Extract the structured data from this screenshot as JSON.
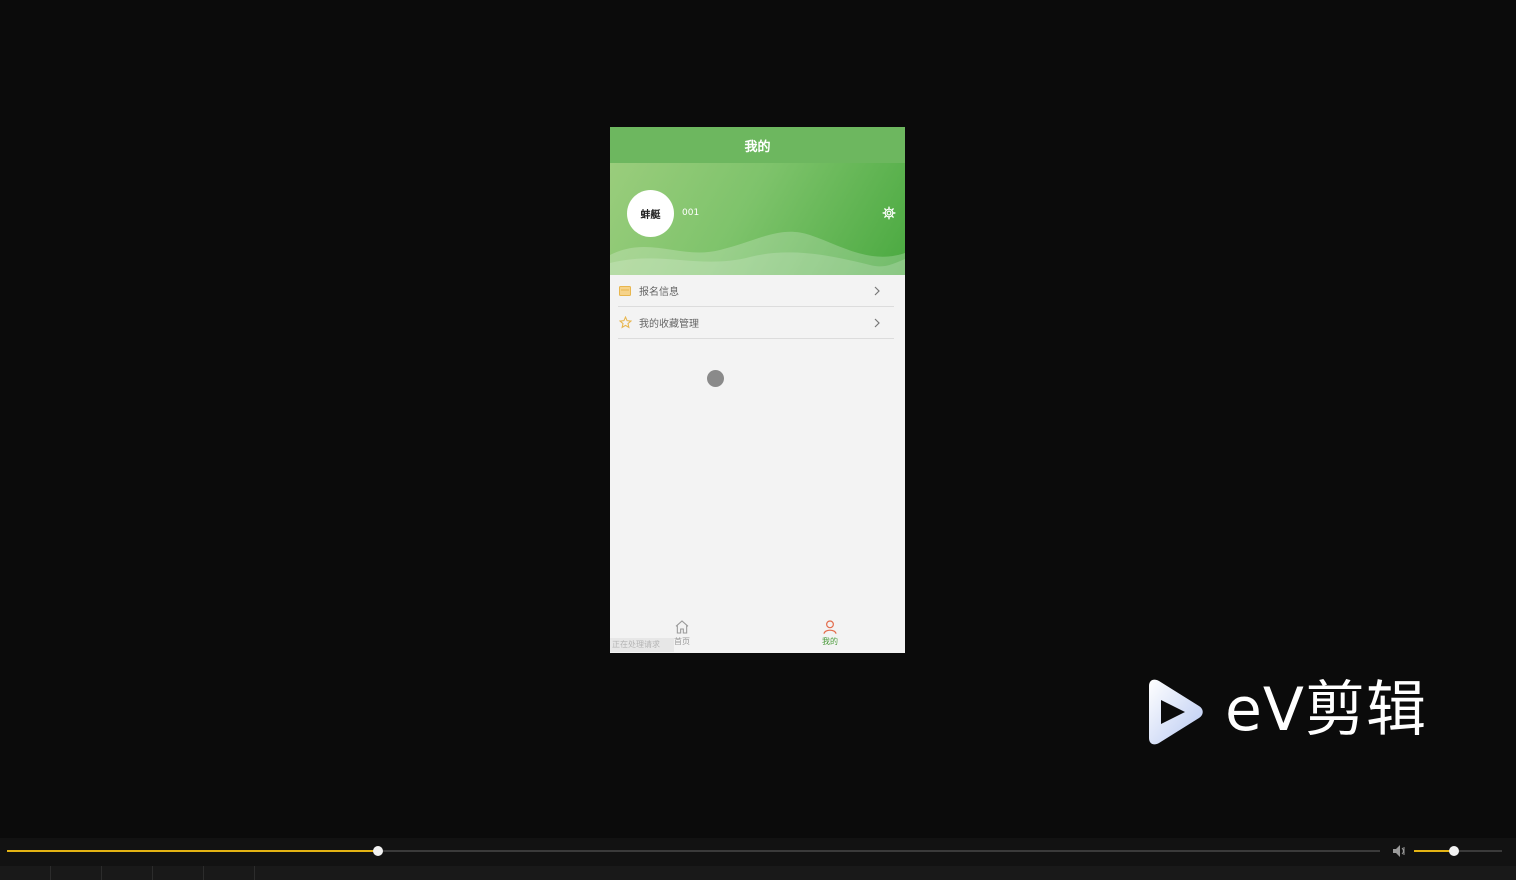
{
  "app": {
    "title": "我的",
    "profile": {
      "avatar_text": "蚌艇",
      "username": "001"
    },
    "menu": [
      {
        "label": "报名信息",
        "icon": "id-card-icon"
      },
      {
        "label": "我的收藏管理",
        "icon": "star-icon"
      }
    ],
    "tabs": [
      {
        "label": "首页",
        "icon": "home-icon",
        "active": false
      },
      {
        "label": "我的",
        "icon": "user-icon",
        "active": true
      }
    ],
    "toast": "正在处理请求"
  },
  "watermark": {
    "text": "eV剪辑",
    "icon": "play-logo-icon"
  },
  "player": {
    "progress": 0.27,
    "volume": 0.45
  },
  "colors": {
    "accent": "#6db75f",
    "player_accent": "#e3b314",
    "tab_active": "#e36c4c"
  }
}
